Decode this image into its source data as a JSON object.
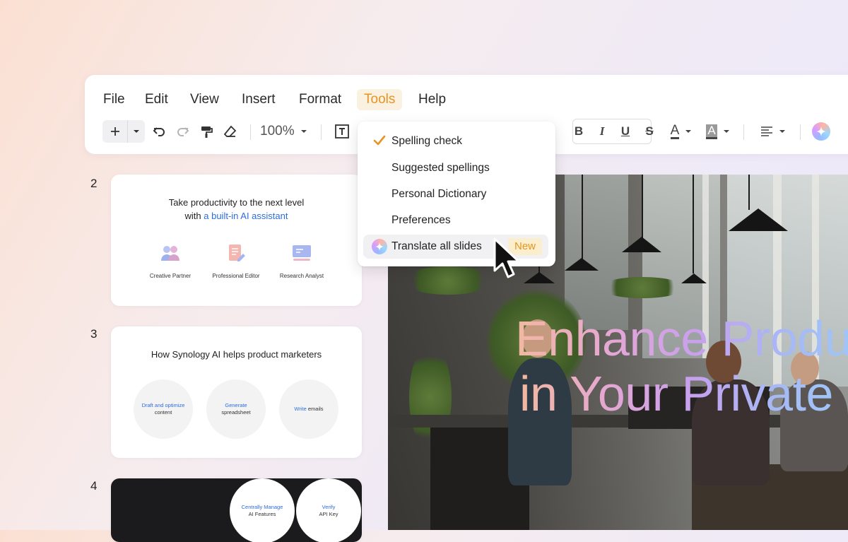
{
  "menu": {
    "items": [
      "File",
      "Edit",
      "View",
      "Insert",
      "Format",
      "Tools",
      "Help"
    ],
    "active": "Tools"
  },
  "toolbar": {
    "zoom": "100%",
    "bold": "B",
    "italic": "I",
    "underline": "U",
    "strikethrough": "S",
    "font_color": "A",
    "highlight": "A"
  },
  "tools_menu": {
    "items": [
      {
        "label": "Spelling check",
        "checked": true
      },
      {
        "label": "Suggested spellings"
      },
      {
        "label": "Personal Dictionary"
      },
      {
        "label": "Preferences"
      },
      {
        "label": "Translate all slides",
        "badge": "New",
        "highlighted": true
      }
    ]
  },
  "slides": {
    "numbers": [
      "2",
      "3",
      "4"
    ],
    "slide2": {
      "line1": "Take productivity to the next level",
      "line2_prefix": "with ",
      "line2_accent": "a built-in AI assistant",
      "features": [
        "Creative Partner",
        "Professional Editor",
        "Research Analyst"
      ]
    },
    "slide3": {
      "title": "How Synology AI helps product marketers",
      "circles": [
        {
          "accent": "Draft and optimize",
          "rest": "content"
        },
        {
          "accent": "Generate",
          "rest": "spreadsheet"
        },
        {
          "accent": "Write",
          "rest": " emails"
        }
      ]
    },
    "slide4": {
      "circles": [
        {
          "accent": "Centrally Manage",
          "rest": "AI Features"
        },
        {
          "accent": "Verify",
          "rest": "API Key"
        }
      ]
    }
  },
  "main_slide": {
    "line1": "Enhance Produ",
    "line2": "in Your Private"
  },
  "colors": {
    "accent_orange": "#e79422",
    "link_blue": "#2d6cdf"
  }
}
